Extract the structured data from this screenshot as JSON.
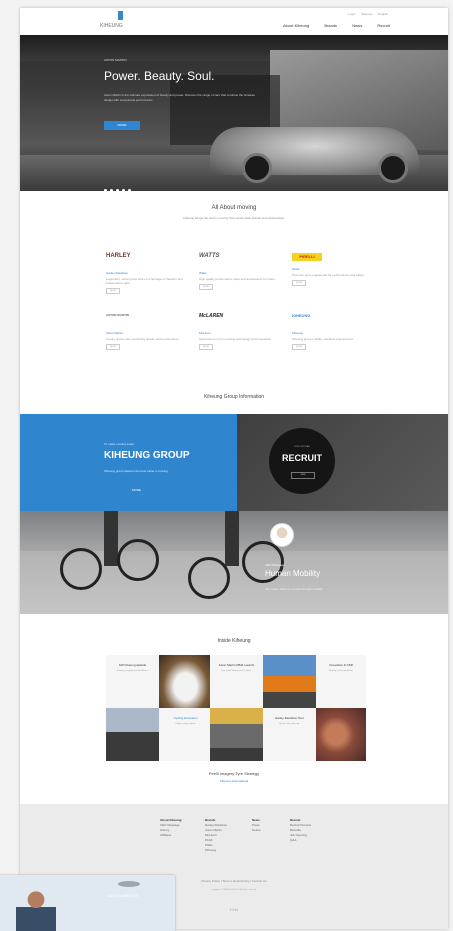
{
  "header": {
    "logo_text": "KIHEUNG",
    "util_links": [
      "Login",
      "Sitemap",
      "English"
    ],
    "nav": [
      "About Kiheung",
      "Brands",
      "News",
      "Recruit"
    ]
  },
  "hero": {
    "emblem_text": "ASTON MARTIN",
    "title": "Power. Beauty. Soul.",
    "description": "Aston Martin is the ultimate expression of beauty and power. Discover the range of cars that combine the timeless design with exceptional performance.",
    "button_label": "MORE",
    "slide_count": 5
  },
  "about": {
    "title": "All About moving",
    "subtitle": "Kiheung brings the best in moving from world-class brands and partnerships."
  },
  "brands": [
    {
      "logo": "HARLEY",
      "name": "Harley-Davidson",
      "desc": "Legendary motorcycles built on a heritage of freedom and independent spirit.",
      "more": "MORE"
    },
    {
      "logo": "WATTS",
      "name": "Watts",
      "desc": "High quality performance parts and accessories for riders.",
      "more": "MORE"
    },
    {
      "logo": "PIRELLI",
      "name": "Pirelli",
      "desc": "Premium tyres engineered for performance and safety.",
      "more": "MORE"
    },
    {
      "logo": "ASTON MARTIN",
      "name": "Aston Martin",
      "desc": "Luxury sports cars combining beauty and performance.",
      "more": "MORE"
    },
    {
      "logo": "McLAREN",
      "name": "McLaren",
      "desc": "Supercars born from racing technology and innovation.",
      "more": "MORE"
    },
    {
      "logo": "KIHEUNG",
      "name": "Kiheung",
      "desc": "Kiheung group mobility solutions and services.",
      "more": "MORE"
    }
  ],
  "group_info": {
    "title": "Kiheung Group Information",
    "blue_small": "To make moving smart",
    "blue_title": "KIHEUNG GROUP",
    "blue_desc": "Kiheung group delivers the best value in moving.",
    "blue_more": "MORE",
    "recruit_small": "JOIN OUR TEAM",
    "recruit_title": "RECRUIT",
    "recruit_btn": "VIEW"
  },
  "mobility": {
    "small": "CEO Message",
    "title": "Human Mobility",
    "desc": "We create value for people through mobility."
  },
  "inside": {
    "title": "Inside Kiheung",
    "tiles": [
      {
        "title": "SW Kiheung Awards",
        "desc": "Kiheung recognized for excellence."
      },
      {
        "title": "Aston Martin DB11 Launch",
        "desc": "New model launch event in Seoul."
      },
      {
        "title": "Innovation & CSR",
        "desc": "Kiheung social contribution."
      },
      {
        "title": "Cycling Education",
        "desc": "Riding safety program."
      },
      {
        "title": "Harley-Davidson Tour",
        "desc": "Annual rider gathering."
      }
    ],
    "footer_line1": "Pirelli Imagery Tyre Strategy",
    "footer_line2": "Kiheung International"
  },
  "footer": {
    "columns": [
      {
        "head": "About Kiheung",
        "items": [
          "CEO Message",
          "History",
          "Affiliates"
        ]
      },
      {
        "head": "Brands",
        "items": [
          "Harley-Davidson",
          "Aston Martin",
          "McLaren",
          "Pirelli",
          "Watts",
          "Kiheung"
        ]
      },
      {
        "head": "News",
        "items": [
          "Press",
          "Notice"
        ]
      },
      {
        "head": "Recruit",
        "items": [
          "Recruit Process",
          "Benefits",
          "Job Opening",
          "Q&A"
        ]
      }
    ],
    "links": "Privacy Policy | Terms | Email Policy | Contact Us",
    "address": "Copyright © KIHEUNG GROUP. All rights reserved.",
    "social": "f  t  in"
  },
  "overlay": {
    "text": "ASTON MARTIN"
  },
  "colors": {
    "accent": "#2f86cf"
  }
}
